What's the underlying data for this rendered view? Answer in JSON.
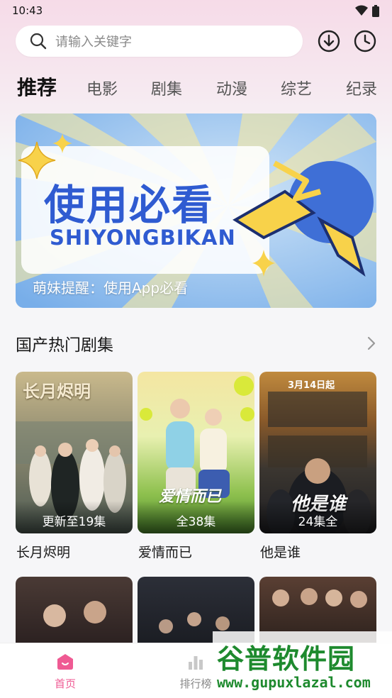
{
  "status_bar": {
    "time": "10:43"
  },
  "search": {
    "placeholder": "请输入关键字"
  },
  "tabs": [
    {
      "label": "推荐",
      "active": true
    },
    {
      "label": "电影"
    },
    {
      "label": "剧集"
    },
    {
      "label": "动漫"
    },
    {
      "label": "综艺"
    },
    {
      "label": "纪录"
    }
  ],
  "banner": {
    "title": "使用必看",
    "subtitle": "SHIYONGBIKAN",
    "caption": "萌妹提醒：使用App必看"
  },
  "section": {
    "title": "国产热门剧集"
  },
  "shows": [
    {
      "title": "长月烬明",
      "episode_info": "更新至19集",
      "poster_text": "长月烬明"
    },
    {
      "title": "爱情而已",
      "episode_info": "全38集",
      "poster_text": "爱情而已"
    },
    {
      "title": "他是谁",
      "episode_info": "24集全",
      "poster_text": "他是谁",
      "poster_date": "3月14日起"
    }
  ],
  "bottom_nav": [
    {
      "label": "首页",
      "icon": "home-icon",
      "active": true
    },
    {
      "label": "排行榜",
      "icon": "bar-chart-icon"
    }
  ],
  "watermark": {
    "title": "谷普软件园",
    "url": "www.gupuxlazal.com"
  },
  "colors": {
    "accent": "#ef5a93",
    "banner_blue": "#2f5bd1",
    "watermark_green": "#1e8a2e"
  }
}
